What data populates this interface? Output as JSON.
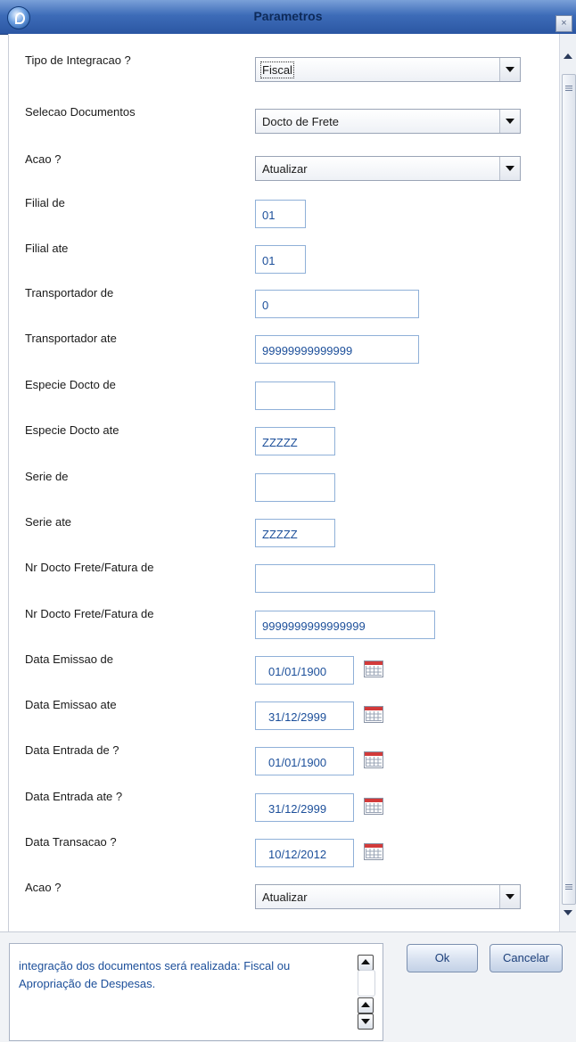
{
  "window": {
    "title": "Parametros",
    "close_label": "×"
  },
  "params": [
    {
      "label": "Tipo de Integracao ?",
      "type": "combo",
      "value": "Fiscal",
      "focused": true
    },
    {
      "label": "Selecao Documentos",
      "type": "combo",
      "value": "Docto de Frete"
    },
    {
      "label": "Acao ?",
      "type": "combo",
      "value": "Atualizar"
    },
    {
      "label": "Filial de",
      "type": "text",
      "value": "01"
    },
    {
      "label": "Filial ate",
      "type": "text",
      "value": "01"
    },
    {
      "label": "Transportador de",
      "type": "text",
      "value": "0"
    },
    {
      "label": "Transportador ate",
      "type": "text",
      "value": "99999999999999"
    },
    {
      "label": "Especie Docto de",
      "type": "text",
      "value": ""
    },
    {
      "label": "Especie Docto ate",
      "type": "text",
      "value": "ZZZZZ"
    },
    {
      "label": "Serie de",
      "type": "text",
      "value": ""
    },
    {
      "label": "Serie ate",
      "type": "text",
      "value": "ZZZZZ"
    },
    {
      "label": "Nr Docto Frete/Fatura de",
      "type": "text",
      "value": ""
    },
    {
      "label": "Nr Docto Frete/Fatura de",
      "type": "text",
      "value": "9999999999999999"
    },
    {
      "label": "Data Emissao de",
      "type": "date",
      "value": "01/01/1900"
    },
    {
      "label": "Data Emissao ate",
      "type": "date",
      "value": "31/12/2999"
    },
    {
      "label": "Data Entrada de ?",
      "type": "date",
      "value": "01/01/1900"
    },
    {
      "label": "Data Entrada ate ?",
      "type": "date",
      "value": "31/12/2999"
    },
    {
      "label": "Data Transacao ?",
      "type": "date",
      "value": "10/12/2012"
    },
    {
      "label": "Acao ?",
      "type": "combo",
      "value": "Atualizar"
    }
  ],
  "help": {
    "text": "integração dos documentos será realizada: Fiscal ou Apropriação de Despesas."
  },
  "buttons": {
    "ok": "Ok",
    "cancel": "Cancelar"
  },
  "icons": {
    "calendar": "calendar-icon",
    "dropdown": "chevron-down-icon",
    "close": "close-icon",
    "logo": "app-logo-icon"
  },
  "colors": {
    "titlebar": "#3d6cb8",
    "value_text": "#1c4f9a",
    "field_border": "#8fb0d8",
    "button": "#d7e1f0"
  }
}
